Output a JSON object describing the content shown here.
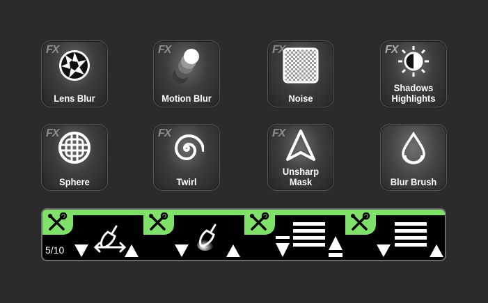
{
  "tiles": [
    {
      "label": "Lens Blur",
      "fx": "FX",
      "icon": "aperture-icon"
    },
    {
      "label": "Motion Blur",
      "fx": "FX",
      "icon": "motion-blur-icon"
    },
    {
      "label": "Noise",
      "fx": "FX",
      "icon": "checkerboard-icon"
    },
    {
      "label": "Shadows Highlights",
      "label_line1": "Shadows",
      "label_line2": "Highlights",
      "fx": "FX",
      "icon": "half-sun-icon"
    },
    {
      "label": "Sphere",
      "fx": "FX",
      "icon": "sphere-icon"
    },
    {
      "label": "Twirl",
      "fx": "FX",
      "icon": "spiral-icon"
    },
    {
      "label": "Unsharp Mask",
      "label_line1": "Unsharp",
      "label_line2": "Mask",
      "fx": "FX",
      "icon": "sharpen-triangle-icon"
    },
    {
      "label": "Blur Brush",
      "fx": "",
      "icon": "drop-icon"
    }
  ],
  "strip": {
    "counter": "5/10",
    "segments": [
      {
        "tab_icon": "tools-icon",
        "main_icon": "brush-size-icon"
      },
      {
        "tab_icon": "tools-icon",
        "main_icon": "brush-softness-icon"
      },
      {
        "tab_icon": "tools-icon",
        "main_icon": "layers-stack-icon"
      },
      {
        "tab_icon": "tools-icon",
        "main_icon": "layers-stack-icon"
      }
    ]
  },
  "colors": {
    "accent": "#7fe06a",
    "background": "#2b2b2b"
  }
}
